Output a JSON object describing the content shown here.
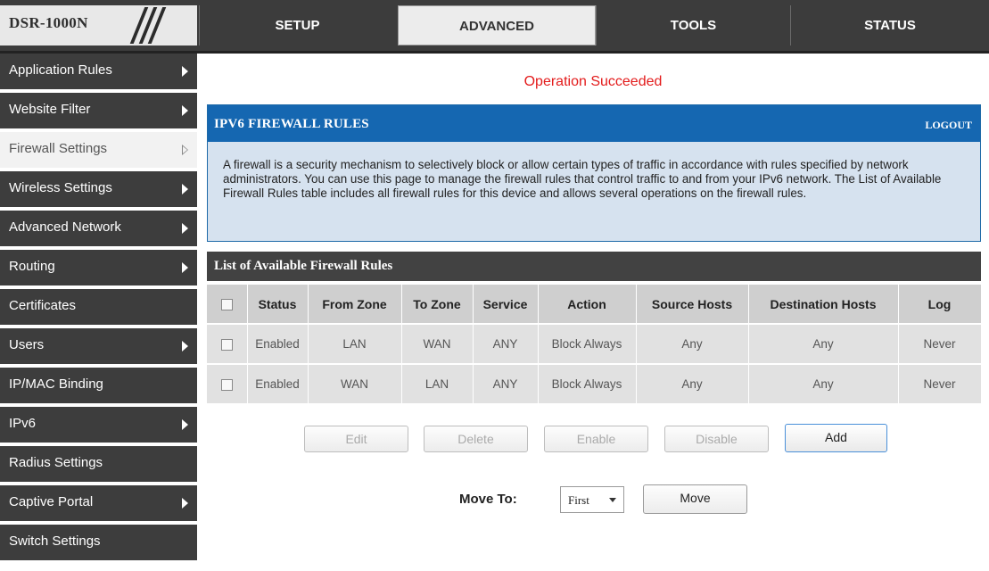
{
  "header": {
    "logo": "DSR-1000N",
    "tabs": [
      "SETUP",
      "ADVANCED",
      "TOOLS",
      "STATUS"
    ],
    "active_tab": "ADVANCED"
  },
  "sidebar": {
    "items": [
      {
        "label": "Application Rules",
        "arrow": true
      },
      {
        "label": "Website Filter",
        "arrow": true
      },
      {
        "label": "Firewall Settings",
        "arrow": true,
        "active": true
      },
      {
        "label": "Wireless Settings",
        "arrow": true
      },
      {
        "label": "Advanced Network",
        "arrow": true
      },
      {
        "label": "Routing",
        "arrow": true
      },
      {
        "label": "Certificates",
        "arrow": false
      },
      {
        "label": "Users",
        "arrow": true
      },
      {
        "label": "IP/MAC Binding",
        "arrow": false
      },
      {
        "label": "IPv6",
        "arrow": true
      },
      {
        "label": "Radius Settings",
        "arrow": false
      },
      {
        "label": "Captive Portal",
        "arrow": true
      },
      {
        "label": "Switch Settings",
        "arrow": false
      }
    ]
  },
  "main": {
    "status_message": "Operation Succeeded",
    "panel_title": "IPV6 FIREWALL RULES",
    "logout": "LOGOUT",
    "description": "A firewall is a security mechanism to selectively block or allow certain types of traffic in accordance with rules specified by network administrators. You can use this page to manage the firewall rules that control traffic to and from your IPv6 network. The List of Available Firewall Rules table includes all firewall rules for this device and allows several operations on the firewall rules.",
    "list_title": "List of Available Firewall Rules",
    "table": {
      "columns": [
        "Status",
        "From Zone",
        "To Zone",
        "Service",
        "Action",
        "Source Hosts",
        "Destination Hosts",
        "Log"
      ],
      "rows": [
        [
          "Enabled",
          "LAN",
          "WAN",
          "ANY",
          "Block Always",
          "Any",
          "Any",
          "Never"
        ],
        [
          "Enabled",
          "WAN",
          "LAN",
          "ANY",
          "Block Always",
          "Any",
          "Any",
          "Never"
        ]
      ]
    },
    "buttons": {
      "edit": "Edit",
      "delete": "Delete",
      "enable": "Enable",
      "disable": "Disable",
      "add": "Add"
    },
    "move": {
      "label": "Move To:",
      "selected": "First",
      "button": "Move"
    }
  },
  "colors": {
    "topbar": "#3c3c3c",
    "sidebar": "#3d3d3d",
    "panel_header": "#1567b1",
    "panel_body": "#d6e2ef",
    "status_red": "#e31b1b"
  }
}
